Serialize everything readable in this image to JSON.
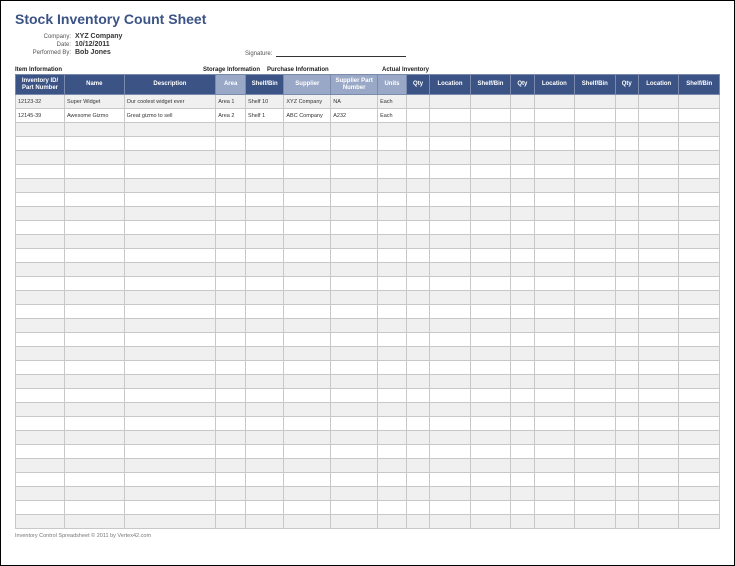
{
  "title": "Stock Inventory Count Sheet",
  "meta": {
    "company_label": "Company:",
    "company": "XYZ Company",
    "date_label": "Date:",
    "date": "10/12/2011",
    "performed_by_label": "Performed By:",
    "performed_by": "Bob Jones",
    "signature_label": "Signature:"
  },
  "sections": {
    "item": "Item Information",
    "storage": "Storage Information",
    "purchase": "Purchase Information",
    "actual": "Actual Inventory"
  },
  "columns": {
    "inventory_id": "Inventory ID/\nPart Number",
    "name": "Name",
    "description": "Description",
    "area": "Area",
    "shelf_bin": "Shelf/Bin",
    "supplier": "Supplier",
    "supplier_part": "Supplier Part\nNumber",
    "units": "Units",
    "qty": "Qty",
    "location": "Location",
    "shelf_bin2": "Shelf/Bin"
  },
  "rows": [
    {
      "id": "12123-32",
      "name": "Super Widget",
      "desc": "Our coolest widget ever",
      "area": "Area 1",
      "bin": "Shelf 10",
      "supplier": "XYZ Company",
      "sp_part": "NA",
      "units": "Each"
    },
    {
      "id": "12145-39",
      "name": "Awesome Gizmo",
      "desc": "Great gizmo to sell",
      "area": "Area 2",
      "bin": "Shelf 1",
      "supplier": "ABC Company",
      "sp_part": "A232",
      "units": "Each"
    }
  ],
  "empty_rows": 29,
  "footer": "Inventory Control Spreadsheet © 2011 by Vertex42.com"
}
